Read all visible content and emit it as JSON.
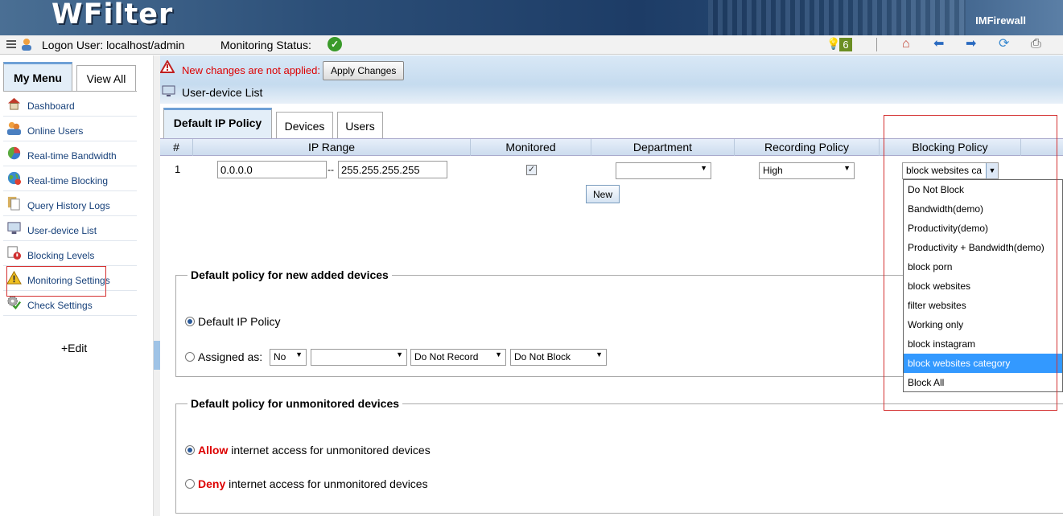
{
  "app": {
    "logo": "WFilter",
    "brand": "IMFirewall"
  },
  "statusbar": {
    "logon": "Logon User: localhost/admin",
    "monitoring": "Monitoring Status:",
    "notification_count": "6"
  },
  "sidebar": {
    "tabs": [
      "My Menu",
      "View All"
    ],
    "items": [
      {
        "label": "Dashboard",
        "icon": "house-icon"
      },
      {
        "label": "Online Users",
        "icon": "users-icon"
      },
      {
        "label": "Real-time Bandwidth",
        "icon": "pie-chart-icon"
      },
      {
        "label": "Real-time Blocking",
        "icon": "globe-icon"
      },
      {
        "label": "Query History Logs",
        "icon": "documents-icon"
      },
      {
        "label": "User-device List",
        "icon": "monitor-icon"
      },
      {
        "label": "Blocking Levels",
        "icon": "blocking-icon"
      },
      {
        "label": "Monitoring Settings",
        "icon": "warning-icon"
      },
      {
        "label": "Check Settings",
        "icon": "gear-check-icon"
      }
    ],
    "edit": "+Edit"
  },
  "notice": {
    "message": "New changes are not applied:",
    "apply": "Apply Changes"
  },
  "page_title": "User-device List",
  "tabs": [
    "Default IP Policy",
    "Devices",
    "Users"
  ],
  "grid": {
    "headers": [
      "#",
      "IP Range",
      "Monitored",
      "Department",
      "Recording Policy",
      "Blocking Policy"
    ],
    "row": {
      "num": "1",
      "ip_from": "0.0.0.0",
      "sep": "--",
      "ip_to": "255.255.255.255",
      "monitored": true,
      "department": "",
      "recording": "High",
      "blocking": "block websites ca"
    },
    "new_button": "New"
  },
  "blocking_options": [
    "Do Not Block",
    "Bandwidth(demo)",
    "Productivity(demo)",
    "Productivity + Bandwidth(demo)",
    "block porn",
    "block websites",
    "filter websites",
    "Working only",
    "block instagram",
    "block websites category",
    "Block All"
  ],
  "highlighted_option": "block websites category",
  "new_devices": {
    "legend": "Default policy for new added devices",
    "default_label": "Default IP Policy",
    "assigned_label": "Assigned as:",
    "assigned_monitor": "No",
    "assigned_department": "",
    "assigned_record": "Do Not Record",
    "assigned_block": "Do Not Block"
  },
  "unmonitored": {
    "legend": "Default policy for unmonitored devices",
    "allow_word": "Allow",
    "allow_rest": " internet access for unmonitored devices",
    "deny_word": "Deny",
    "deny_rest": " internet access for unmonitored devices",
    "selected": "allow"
  }
}
